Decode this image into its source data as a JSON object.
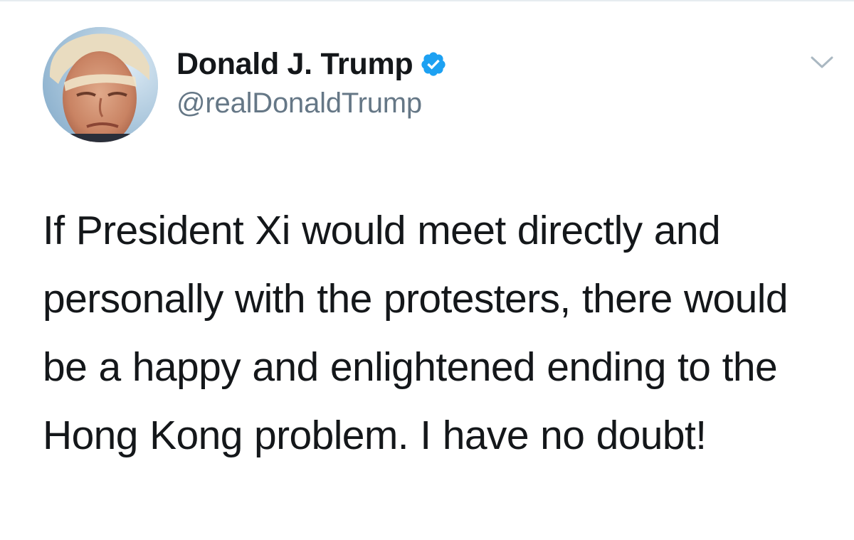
{
  "tweet": {
    "author": {
      "display_name": "Donald J. Trump",
      "handle": "@realDonaldTrump",
      "verified": true,
      "verified_icon": "verified-badge-icon",
      "avatar_icon": "avatar"
    },
    "text": "If President Xi would meet directly and personally with the protesters, there would be a happy and enlightened ending to the Hong Kong problem. I have no doubt!",
    "menu_icon": "chevron-down-icon"
  },
  "colors": {
    "text_primary": "#14171a",
    "text_secondary": "#657786",
    "verified_blue": "#1da1f2",
    "caret_gray": "#aab8c2",
    "divider": "#e6ecf0"
  }
}
